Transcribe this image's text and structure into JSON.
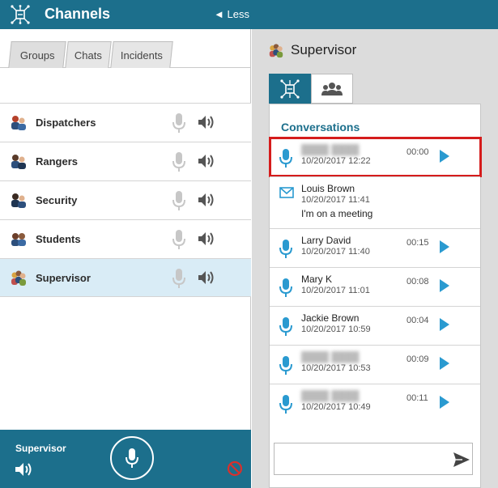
{
  "header": {
    "title": "Channels",
    "less_label": "◄ Less"
  },
  "tabs": [
    {
      "label": "Groups"
    },
    {
      "label": "Chats"
    },
    {
      "label": "Incidents"
    }
  ],
  "channels": [
    {
      "name": "Dispatchers",
      "avatar": "dispatchers-avatar-icon"
    },
    {
      "name": "Rangers",
      "avatar": "rangers-avatar-icon"
    },
    {
      "name": "Security",
      "avatar": "security-avatar-icon"
    },
    {
      "name": "Students",
      "avatar": "students-avatar-icon"
    },
    {
      "name": "Supervisor",
      "avatar": "supervisor-avatar-icon",
      "selected": true
    }
  ],
  "bottom_bar": {
    "current_channel": "Supervisor"
  },
  "right_panel": {
    "title": "Supervisor",
    "conversations_title": "Conversations",
    "conversations": [
      {
        "type": "voice",
        "name": "████ ████",
        "date": "10/20/2017 12:22",
        "duration": "00:00",
        "blurred": true,
        "highlighted": true
      },
      {
        "type": "message",
        "name": "Louis Brown",
        "date": "10/20/2017 11:41",
        "body": "I'm on a meeting"
      },
      {
        "type": "voice",
        "name": "Larry David",
        "date": "10/20/2017 11:40",
        "duration": "00:15"
      },
      {
        "type": "voice",
        "name": "Mary K",
        "date": "10/20/2017 11:01",
        "duration": "00:08"
      },
      {
        "type": "voice",
        "name": "Jackie Brown",
        "date": "10/20/2017 10:59",
        "duration": "00:04"
      },
      {
        "type": "voice",
        "name": "████ ████",
        "date": "10/20/2017 10:53",
        "duration": "00:09",
        "blurred": true
      },
      {
        "type": "voice",
        "name": "████ ████",
        "date": "10/20/2017 10:49",
        "duration": "00:11",
        "blurred": true
      }
    ],
    "compose_placeholder": ""
  },
  "colors": {
    "brand": "#1c6f8c",
    "accent_blue": "#2a9ad0",
    "selected_row": "#d9ecf6",
    "highlight_red": "#d51c1c",
    "mute_red": "#d9302c"
  }
}
